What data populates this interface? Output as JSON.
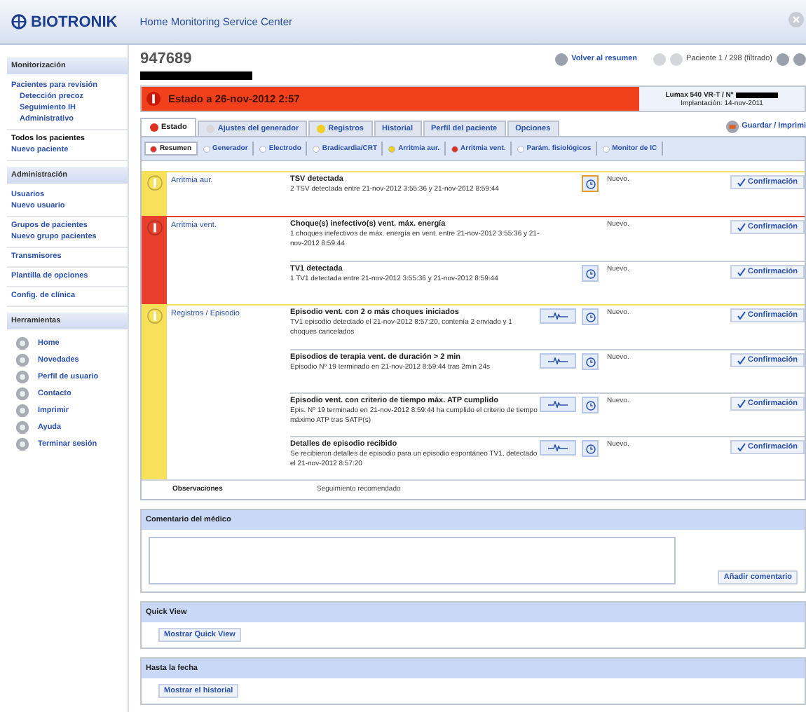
{
  "header": {
    "logo": "BIOTRONIK",
    "title": "Home Monitoring Service Center"
  },
  "sidebar": {
    "sections": [
      {
        "title": "Monitorización",
        "groups": [
          [
            {
              "label": "Pacientes para revisión",
              "children": [
                {
                  "label": "Detección precoz"
                },
                {
                  "label": "Seguimiento IH"
                },
                {
                  "label": "Administrativo"
                }
              ]
            }
          ],
          [
            {
              "label": "Todos los pacientes",
              "selected": true
            },
            {
              "label": "Nuevo paciente",
              "selected": false
            }
          ]
        ]
      },
      {
        "title": "Administración",
        "groups": [
          [
            {
              "label": "Usuarios"
            },
            {
              "label": "Nuevo usuario"
            }
          ],
          [
            {
              "label": "Grupos de pacientes"
            },
            {
              "label": "Nuevo grupo pacientes"
            }
          ],
          [
            {
              "label": "Transmisores"
            }
          ],
          [
            {
              "label": "Plantilla de opciones"
            }
          ],
          [
            {
              "label": "Config. de clínica"
            }
          ]
        ]
      },
      {
        "title": "Herramientas",
        "tools": [
          "Home",
          "Novedades",
          "Perfil de usuario",
          "Contacto",
          "Imprimir",
          "Ayuda",
          "Terminar sesión"
        ]
      }
    ]
  },
  "patient": {
    "id": "947689",
    "back": "Volver al resumen",
    "position": "Paciente 1 / 298 (filtrado)"
  },
  "status": {
    "title": "Estado a 26-nov-2012 2:57",
    "color": "#f0401c",
    "device": "Lumax 540 VR-T / Nº",
    "implant": "Implantación: 14-nov-2011"
  },
  "tabs": [
    {
      "label": "Estado",
      "selected": true,
      "color": "#e03020"
    },
    {
      "label": "Ajustes del generador",
      "selected": false,
      "color": "#d8d8d8"
    },
    {
      "label": "Registros",
      "selected": false,
      "color": "#f0d020"
    },
    {
      "label": "Historial",
      "selected": false
    },
    {
      "label": "Perfil del paciente",
      "selected": false
    },
    {
      "label": "Opciones",
      "selected": false
    }
  ],
  "save_print": "Guardar / Imprimi",
  "subtabs": [
    {
      "label": "Resumen",
      "selected": true,
      "color": "#e03020"
    },
    {
      "label": "Generador",
      "selected": false,
      "color": "#ffffff"
    },
    {
      "label": "Electrodo",
      "selected": false,
      "color": "#ffffff"
    },
    {
      "label": "Bradicardia/CRT",
      "selected": false,
      "color": "#ffffff"
    },
    {
      "label": "Arritmia aur.",
      "selected": false,
      "color": "#f0d020"
    },
    {
      "label": "Arritmia vent.",
      "selected": false,
      "color": "#e03020"
    },
    {
      "label": "Parám. fisiológicos",
      "selected": false,
      "color": "#ffffff"
    },
    {
      "label": "Monitor de IC",
      "selected": false,
      "color": "#ffffff"
    }
  ],
  "groups": [
    {
      "color": "#f7e15a",
      "category": "Arritmia aur.",
      "events": [
        {
          "title": "TSV detectada",
          "detail": "2 TSV detectada entre 21-nov-2012 3:55:36 y 21-nov-2012 8:59:44",
          "egm": false,
          "clock": true,
          "clock_selected": true,
          "state": "Nuevo.",
          "button": "Confirmación"
        }
      ]
    },
    {
      "color": "#e8402c",
      "category": "Arritmia vent.",
      "events": [
        {
          "title": "Choque(s) inefectivo(s) vent. máx. energía",
          "detail": "1 choques inefectivos de máx. energía en vent. entre 21-nov-2012 3:55:36 y 21-nov-2012 8:59:44",
          "egm": false,
          "clock": false,
          "state": "Nuevo.",
          "button": "Confirmación"
        },
        {
          "title": "TV1 detectada",
          "detail": "1 TV1 detectada entre 21-nov-2012 3:55:36 y 21-nov-2012 8:59:44",
          "egm": false,
          "clock": true,
          "clock_selected": false,
          "state": "Nuevo.",
          "button": "Confirmación"
        }
      ]
    },
    {
      "color": "#f7e15a",
      "category": "Registros / Episodio",
      "events": [
        {
          "title": "Episodio vent. con 2 o más choques iniciados",
          "detail": "TV1 episodio detectado el 21-nov-2012 8:57:20, contenía 2 enviado y 1 choques cancelados",
          "egm": true,
          "clock": true,
          "clock_selected": false,
          "state": "Nuevo.",
          "button": "Confirmación"
        },
        {
          "title": "Episodios de terapia vent. de duración > 2 min",
          "detail": "Episodio Nº 19 terminado en 21-nov-2012 8:59:44 tras 2min 24s",
          "egm": true,
          "clock": true,
          "clock_selected": false,
          "state": "Nuevo.",
          "button": "Confirmación"
        },
        {
          "title": "Episodio vent. con criterio de tiempo máx. ATP cumplido",
          "detail": "Epis. Nº 19 terminado en 21-nov-2012 8:59:44 ha cumplido el criterio de tiempo máximo ATP tras SATP(s)",
          "egm": true,
          "clock": true,
          "clock_selected": false,
          "state": "Nuevo.",
          "button": "Confirmación"
        },
        {
          "title": "Detalles de episodio recibido",
          "detail": "Se recibieron detalles de episodio para un episodio espontáneo TV1, detectado el 21-nov-2012 8:57:20",
          "egm": true,
          "clock": true,
          "clock_selected": false,
          "state": "Nuevo.",
          "button": "Confirmación"
        }
      ]
    }
  ],
  "observations": {
    "label": "Observaciones",
    "value": "Seguimiento recomendado"
  },
  "panels": [
    {
      "kind": "comment",
      "title": "Comentario del médico",
      "button": "Añadir comentario"
    },
    {
      "kind": "button",
      "title": "Quick View",
      "button": "Mostrar Quick View"
    },
    {
      "kind": "button",
      "title": "Hasta la fecha",
      "button": "Mostrar el historial"
    }
  ]
}
